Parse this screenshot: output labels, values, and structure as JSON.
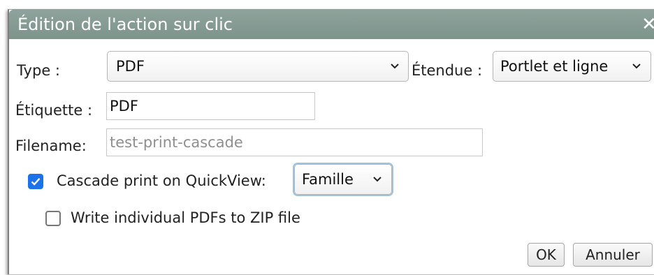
{
  "dialog": {
    "title": "Édition de l'action sur clic",
    "close_symbol": "✕"
  },
  "form": {
    "type_label": "Type :",
    "type_value": "PDF",
    "scope_label": "Étendue :",
    "scope_value": "Portlet et ligne",
    "etiquette_label": "Étiquette :",
    "etiquette_value": "PDF",
    "filename_label": "Filename:",
    "filename_placeholder": "test-print-cascade",
    "cascade_checked": true,
    "cascade_label": "Cascade print on QuickView:",
    "cascade_value": "Famille",
    "zip_checked": false,
    "zip_label": "Write individual PDFs to ZIP file"
  },
  "buttons": {
    "ok_label": "OK",
    "cancel_label": "Annuler"
  },
  "icons": {
    "close": "close-icon",
    "dropdown": "chevron-down-icon",
    "check": "checkmark-icon"
  },
  "colors": {
    "titlebar": "#829890",
    "accent": "#1a73e8",
    "focus_ring": "#9ec3e0"
  }
}
